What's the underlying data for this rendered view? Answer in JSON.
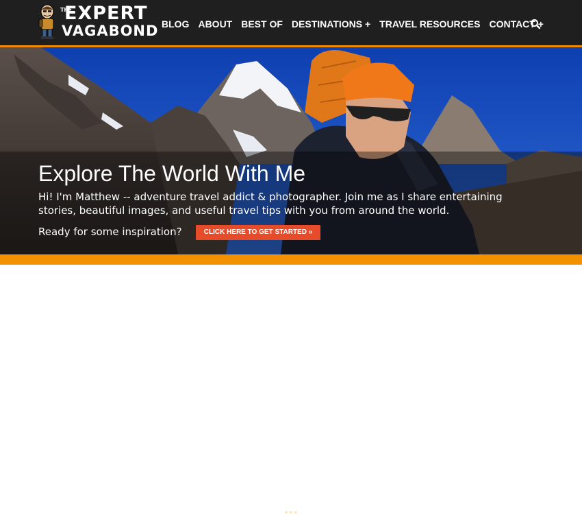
{
  "site": {
    "logo": {
      "prefix": "The",
      "line1": "EXPERT",
      "line2": "VAGABOND"
    }
  },
  "nav": {
    "items": [
      {
        "label": "BLOG"
      },
      {
        "label": "ABOUT"
      },
      {
        "label": "BEST OF"
      },
      {
        "label": "DESTINATIONS +"
      },
      {
        "label": "TRAVEL RESOURCES"
      },
      {
        "label": "CONTACT +"
      }
    ],
    "search_icon": "search-icon"
  },
  "hero": {
    "title": "Explore The World With Me",
    "text": "Hi! I'm Matthew -- adventure travel addict & photographer. Join me as I share entertaining stories, beautiful images, and useful travel tips with you from around the world.",
    "prompt": "Ready for some inspiration?",
    "cta_label": "CLICK HERE TO GET STARTED »"
  },
  "colors": {
    "header_bg": "#1f1f1f",
    "accent_orange": "#f39200",
    "cta_red": "#e74c2a"
  }
}
